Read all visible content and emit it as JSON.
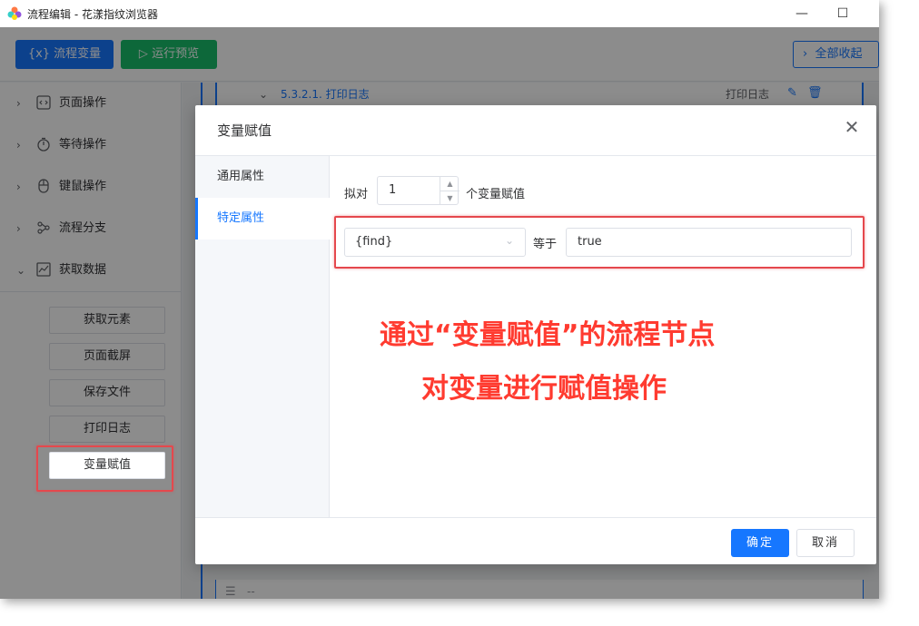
{
  "window": {
    "title": "流程编辑 - 花漾指纹浏览器"
  },
  "toolbar": {
    "variables_label": "{x} 流程变量",
    "preview_label": "运行预览",
    "collapse_label": "全部收起"
  },
  "sidebar": {
    "groups": [
      {
        "label": "页面操作",
        "icon": "code-page-icon"
      },
      {
        "label": "等待操作",
        "icon": "stopwatch-icon"
      },
      {
        "label": "键鼠操作",
        "icon": "mouse-icon"
      },
      {
        "label": "流程分支",
        "icon": "branch-icon"
      },
      {
        "label": "获取数据",
        "icon": "chart-icon"
      }
    ],
    "nodes": [
      "获取元素",
      "页面截屏",
      "保存文件",
      "打印日志",
      "变量赋值"
    ]
  },
  "canvas": {
    "flow_title": "5.3.2.1. 打印日志",
    "flow_type": "打印日志",
    "comment": "--"
  },
  "dialog": {
    "title": "变量赋值",
    "tabs": [
      "通用属性",
      "特定属性"
    ],
    "count_prefix": "拟对",
    "count_value": "1",
    "count_suffix": "个变量赋值",
    "variable": "{find}",
    "equals": "等于",
    "value": "true",
    "ok": "确定",
    "cancel": "取消"
  },
  "annotation": {
    "line1": "通过“变量赋值”的流程节点",
    "line2": "对变量进行赋值操作"
  },
  "colors": {
    "primary": "#1677ff",
    "success": "#19be6b",
    "highlight": "#e5484d"
  }
}
